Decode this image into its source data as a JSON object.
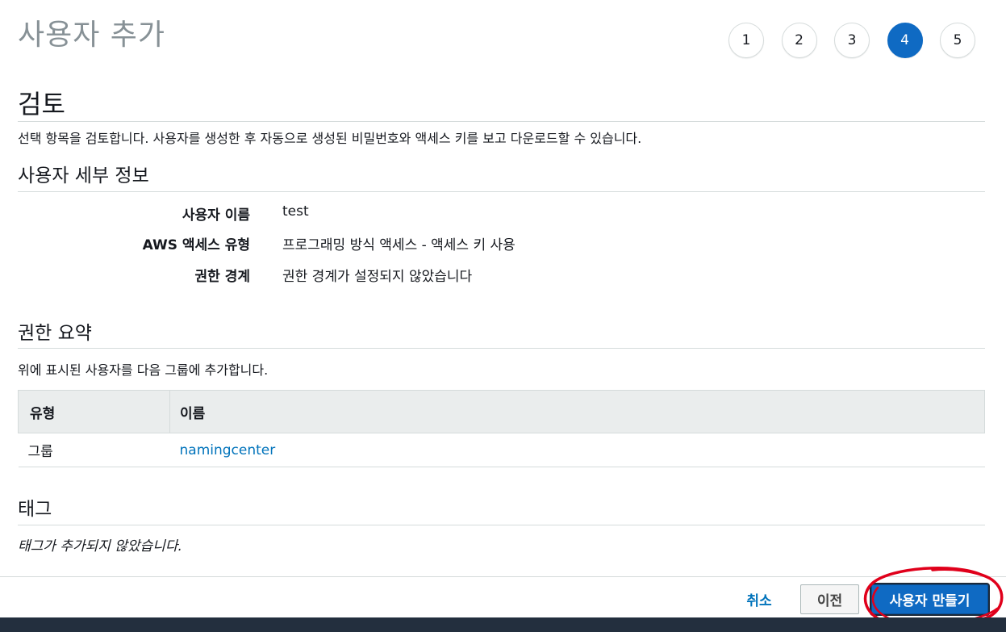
{
  "page": {
    "title": "사용자 추가"
  },
  "steps": [
    "1",
    "2",
    "3",
    "4",
    "5"
  ],
  "active_step": "4",
  "review": {
    "heading": "검토",
    "description": "선택 항목을 검토합니다. 사용자를 생성한 후 자동으로 생성된 비밀번호와 액세스 키를 보고 다운로드할 수 있습니다."
  },
  "user_details": {
    "heading": "사용자 세부 정보",
    "rows": [
      {
        "label": "사용자 이름",
        "value": "test"
      },
      {
        "label": "AWS 액세스 유형",
        "value": "프로그래밍 방식 액세스 - 액세스 키 사용"
      },
      {
        "label": "권한 경계",
        "value": "권한 경계가 설정되지 않았습니다"
      }
    ]
  },
  "permissions": {
    "heading": "권한 요약",
    "description": "위에 표시된 사용자를 다음 그룹에 추가합니다.",
    "columns": [
      "유형",
      "이름"
    ],
    "rows": [
      {
        "type": "그룹",
        "name": "namingcenter"
      }
    ]
  },
  "tags": {
    "heading": "태그",
    "empty_text": "태그가 추가되지 않았습니다."
  },
  "footer": {
    "cancel_label": "취소",
    "previous_label": "이전",
    "create_label": "사용자 만들기"
  },
  "colors": {
    "primary": "#0f6ac3",
    "link": "#0073bb",
    "annotation": "#e0001b",
    "title_gray": "#879196",
    "dark_bar": "#232f3e"
  }
}
